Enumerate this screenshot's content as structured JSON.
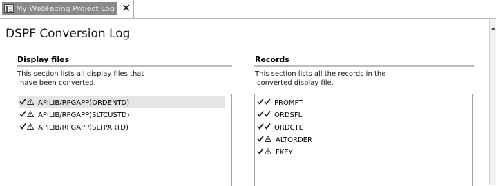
{
  "editor_tab": {
    "label": "My WebFacing Project Log",
    "close_glyph": "✕",
    "icon": "log-document-icon"
  },
  "page": {
    "title": "DSPF Conversion Log"
  },
  "display_files": {
    "heading": "Display files",
    "description_line1": "This section lists all display files that",
    "description_line2": "have been converted.",
    "items": [
      {
        "label": "APILIB/RPGAPP(ORDENTD)",
        "icons": [
          "check-icon",
          "warning-icon"
        ],
        "selected": true
      },
      {
        "label": "APILIB/RPGAPP(SLTCUSTD)",
        "icons": [
          "check-icon",
          "warning-icon"
        ],
        "selected": false
      },
      {
        "label": "APILIB/RPGAPP(SLTPARTD)",
        "icons": [
          "check-icon",
          "warning-icon"
        ],
        "selected": false
      }
    ]
  },
  "records": {
    "heading": "Records",
    "description_line1": "This section lists all the records in the",
    "description_line2": "converted display file.",
    "items": [
      {
        "label": "PROMPT",
        "icons": [
          "check-icon",
          "check-icon"
        ]
      },
      {
        "label": "ORDSFL",
        "icons": [
          "check-icon",
          "check-icon"
        ]
      },
      {
        "label": "ORDCTL",
        "icons": [
          "check-icon",
          "check-icon"
        ]
      },
      {
        "label": "ALTORDER",
        "icons": [
          "check-icon",
          "warning-icon"
        ]
      },
      {
        "label": "FKEY",
        "icons": [
          "check-icon",
          "warning-icon"
        ]
      }
    ]
  },
  "colors": {
    "tab_selected_bg": "#8a8a8a",
    "selected_row_bg": "#e6e6e6",
    "section_rule": "#bdbdbd"
  }
}
